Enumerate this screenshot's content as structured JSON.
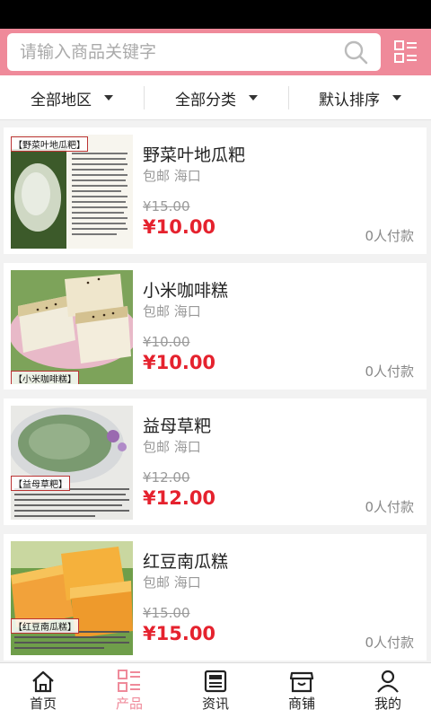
{
  "search": {
    "placeholder": "请输入商品关键字"
  },
  "filters": [
    {
      "label": "全部地区"
    },
    {
      "label": "全部分类"
    },
    {
      "label": "默认排序"
    }
  ],
  "products": [
    {
      "name": "野菜叶地瓜粑",
      "shipping": "包邮 海口",
      "old_price": "¥15.00",
      "price": "¥10.00",
      "paid": "0人付款",
      "image_caption": "【野菜叶地瓜粑】"
    },
    {
      "name": "小米咖啡糕",
      "shipping": "包邮 海口",
      "old_price": "¥10.00",
      "price": "¥10.00",
      "paid": "0人付款",
      "image_caption": "【小米咖啡糕】"
    },
    {
      "name": "益母草粑",
      "shipping": "包邮 海口",
      "old_price": "¥12.00",
      "price": "¥12.00",
      "paid": "0人付款",
      "image_caption": "【益母草粑】"
    },
    {
      "name": "红豆南瓜糕",
      "shipping": "包邮 海口",
      "old_price": "¥15.00",
      "price": "¥15.00",
      "paid": "0人付款",
      "image_caption": "【红豆南瓜糕】"
    }
  ],
  "tabs": [
    {
      "label": "首页",
      "icon": "home-icon"
    },
    {
      "label": "产品",
      "icon": "product-list-icon",
      "active": true
    },
    {
      "label": "资讯",
      "icon": "news-icon"
    },
    {
      "label": "商铺",
      "icon": "shop-icon"
    },
    {
      "label": "我的",
      "icon": "user-icon"
    }
  ],
  "colors": {
    "accent": "#ef8a9a",
    "price": "#e5222e"
  }
}
